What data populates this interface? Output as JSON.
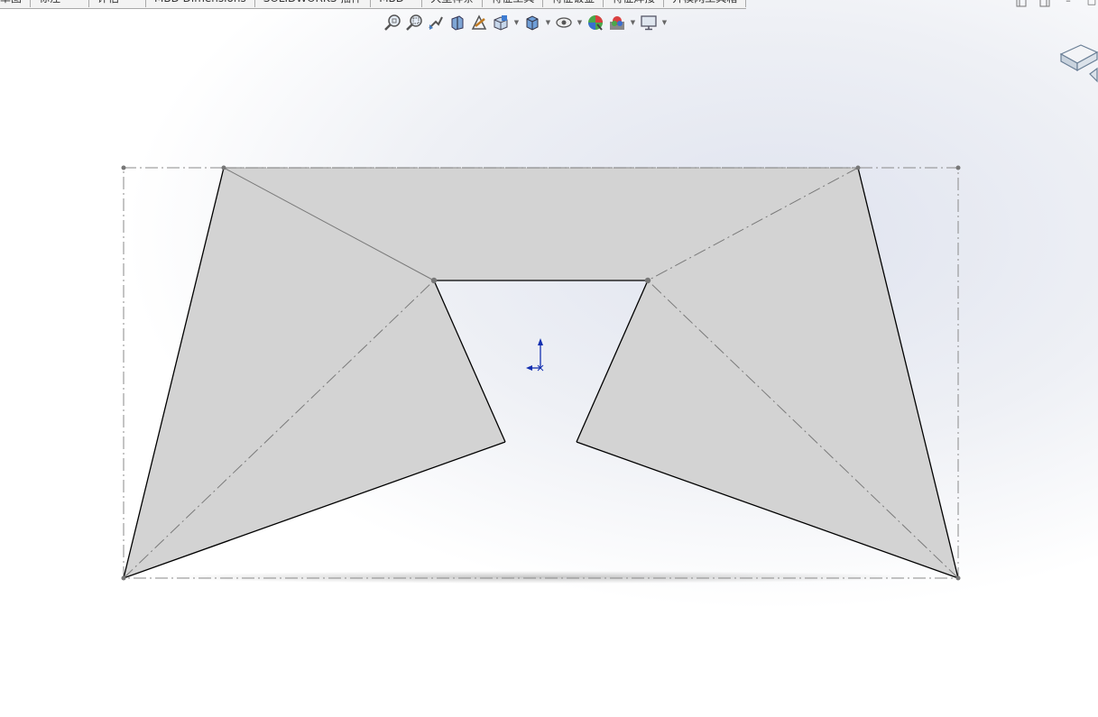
{
  "tabs": [
    {
      "label": "草图"
    },
    {
      "label": "标注"
    },
    {
      "label": "评估"
    },
    {
      "label": "MBD Dimensions"
    },
    {
      "label": "SOLIDWORKS 插件"
    },
    {
      "label": "MBD"
    },
    {
      "label": "大型样条"
    },
    {
      "label": "特征工具"
    },
    {
      "label": "特征钣金"
    },
    {
      "label": "特征焊接"
    },
    {
      "label": "开模网工具箱"
    }
  ],
  "window_controls": {
    "min": "–",
    "restore": "❐",
    "close": "□"
  },
  "hud_toolbar": [
    {
      "name": "zoom-to-fit-icon"
    },
    {
      "name": "zoom-to-area-icon"
    },
    {
      "name": "previous-view-icon"
    },
    {
      "name": "section-view-icon"
    },
    {
      "name": "dynamic-annotation-icon"
    },
    {
      "name": "view-orientation-icon"
    },
    {
      "name": "display-style-icon"
    },
    {
      "name": "hide-show-items-icon"
    },
    {
      "name": "edit-appearance-icon"
    },
    {
      "name": "apply-scene-icon"
    },
    {
      "name": "view-settings-icon"
    }
  ],
  "colors": {
    "face_fill": "#d3d3d3",
    "edge": "#000000",
    "construction_line": "#7a7a7a",
    "origin_axis": "#1530b0"
  }
}
